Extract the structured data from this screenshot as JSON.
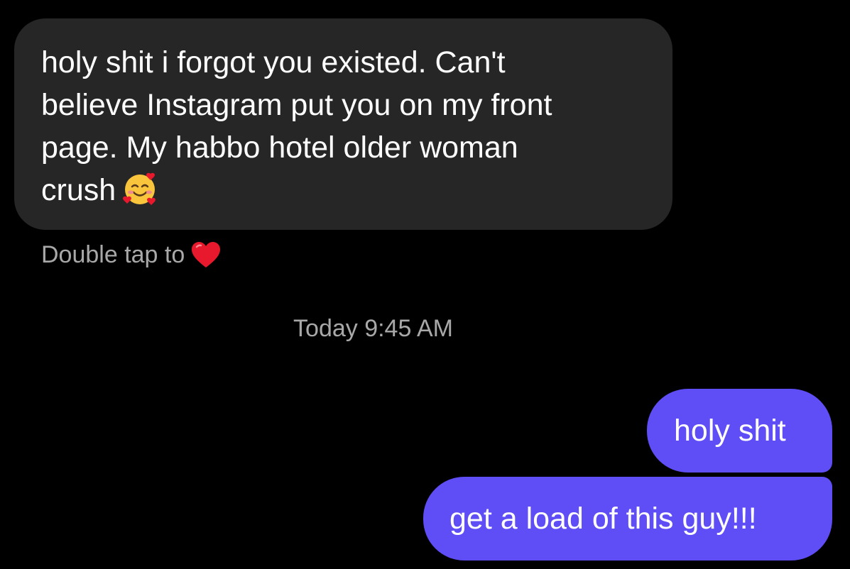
{
  "messages": {
    "incoming": {
      "line1": "holy shit i forgot you existed. Can't",
      "line2": "believe Instagram put you on my front",
      "line3": "page. My habbo hotel older woman",
      "line4": "crush",
      "emoji": "smiling-face-with-hearts-emoji"
    },
    "double_tap_hint": "Double tap to",
    "hint_icon": "heart-icon",
    "timestamp": "Today 9:45 AM",
    "outgoing": [
      {
        "text": "holy shit"
      },
      {
        "text": "get a load of this guy!!!"
      }
    ]
  },
  "colors": {
    "background": "#000000",
    "incoming_bubble": "#262626",
    "outgoing_bubble": "#5f4df5",
    "muted_text": "#a8a8a8",
    "heart": "#e8192c"
  }
}
